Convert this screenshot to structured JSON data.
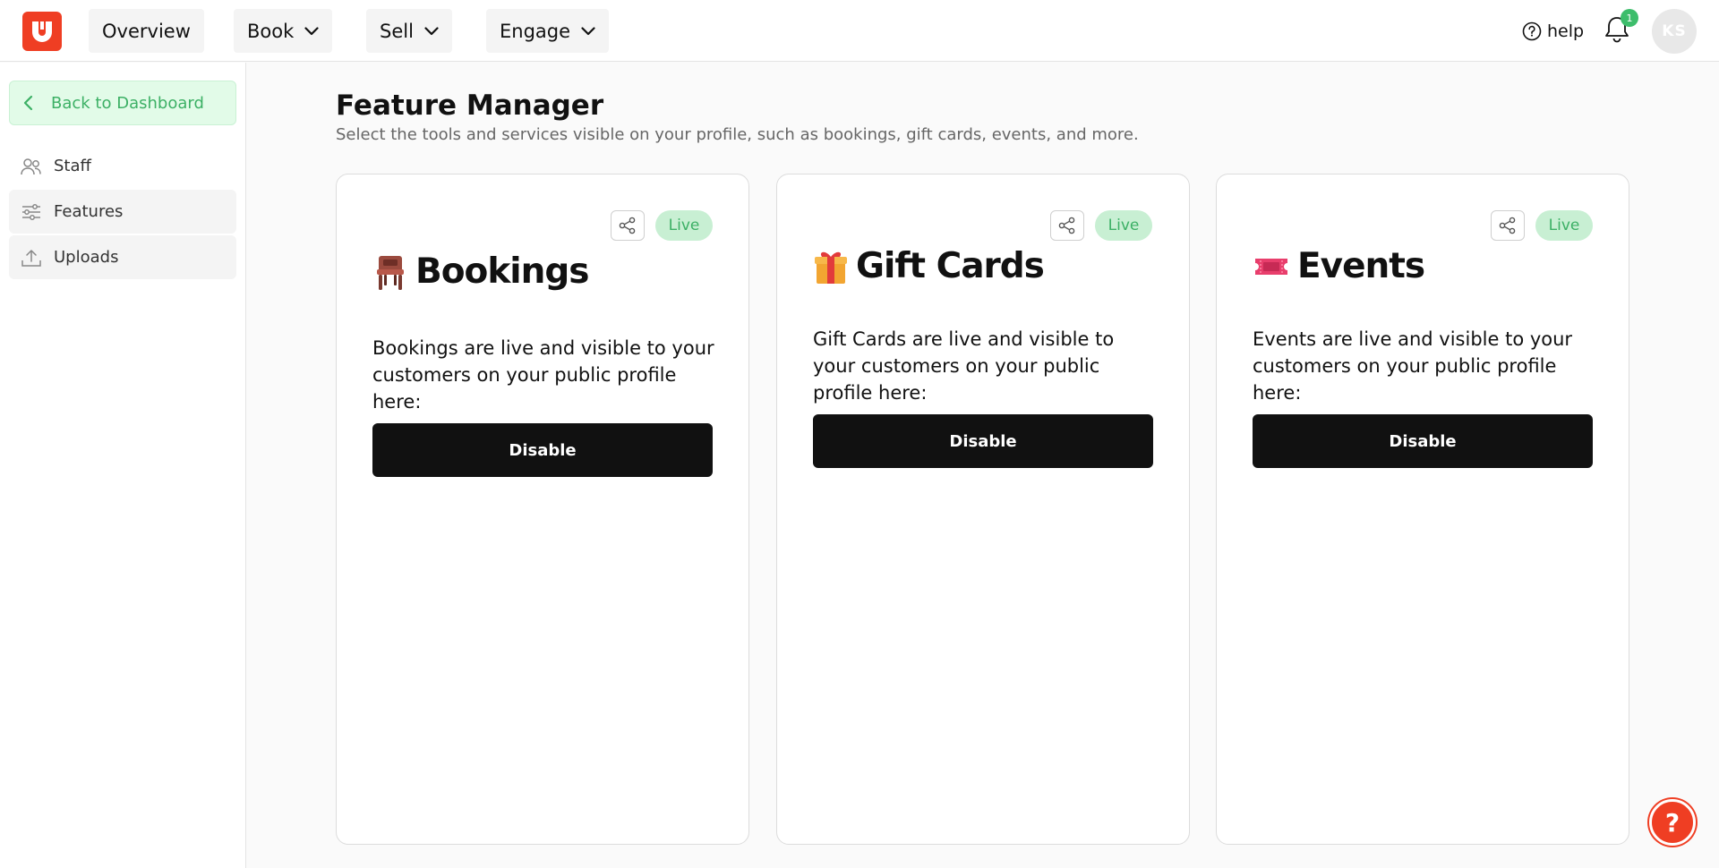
{
  "brand": {
    "accent": "#ef3e23",
    "live_color": "#3cb065"
  },
  "header": {
    "nav": [
      {
        "label": "Overview"
      },
      {
        "label": "Book"
      },
      {
        "label": "Sell"
      },
      {
        "label": "Engage"
      }
    ],
    "help_label": "help",
    "notification_count": "1",
    "avatar_initials": "KS"
  },
  "sidebar": {
    "back_label": "Back to Dashboard",
    "items": [
      {
        "label": "Staff",
        "icon": "users-icon"
      },
      {
        "label": "Features",
        "icon": "sliders-icon"
      },
      {
        "label": "Uploads",
        "icon": "upload-icon"
      }
    ]
  },
  "main": {
    "title": "Feature Manager",
    "subtitle": "Select the tools and services visible on your profile, such as bookings, gift cards, events, and more.",
    "cards": [
      {
        "title": "Bookings",
        "icon": "chair-icon",
        "status": "Live",
        "description": "Bookings are live and visible to your customers on your public profile here:",
        "button_label": "Disable"
      },
      {
        "title": "Gift Cards",
        "icon": "gift-icon",
        "status": "Live",
        "description": "Gift Cards are live and visible to your customers on your public profile here:",
        "button_label": "Disable"
      },
      {
        "title": "Events",
        "icon": "ticket-icon",
        "status": "Live",
        "description": "Events are live and visible to your customers on your public profile here:",
        "button_label": "Disable"
      }
    ]
  },
  "support": {
    "label": "?"
  }
}
